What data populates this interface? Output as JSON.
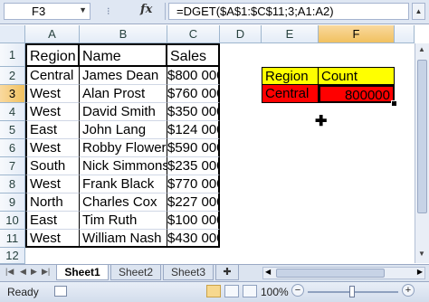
{
  "formula_bar": {
    "name_box": "F3",
    "fx": "fx",
    "formula": "=DGET($A$1:$C$11;3;A1:A2)"
  },
  "columns": [
    "A",
    "B",
    "C",
    "D",
    "E",
    "F"
  ],
  "rows": [
    "1",
    "2",
    "3",
    "4",
    "5",
    "6",
    "7",
    "8",
    "9",
    "10",
    "11",
    "12"
  ],
  "headers": {
    "region": "Region",
    "name": "Name",
    "sales": "Sales"
  },
  "data": [
    {
      "region": "Central",
      "name": "James Dean",
      "sales": "$800 000"
    },
    {
      "region": "West",
      "name": "Alan Prost",
      "sales": "$760 000"
    },
    {
      "region": "West",
      "name": "David Smith",
      "sales": "$350 000"
    },
    {
      "region": "East",
      "name": "John Lang",
      "sales": "$124 000"
    },
    {
      "region": "West",
      "name": "Robby Flowers",
      "sales": "$590 000"
    },
    {
      "region": "South",
      "name": "Nick Simmons",
      "sales": "$235 000"
    },
    {
      "region": "West",
      "name": "Frank Black",
      "sales": "$770 000"
    },
    {
      "region": "North",
      "name": "Charles Cox",
      "sales": "$227 000"
    },
    {
      "region": "East",
      "name": "Tim Ruth",
      "sales": "$100 000"
    },
    {
      "region": "West",
      "name": "William Nash",
      "sales": "$430 000"
    }
  ],
  "criteria": {
    "region_label": "Region",
    "count_label": "Count",
    "region_value": "Central",
    "count_value": "800000"
  },
  "colors": {
    "yellow": "#ffff00",
    "red": "#ff0000",
    "selected_header": "#f1c15f"
  },
  "tabs": [
    "Sheet1",
    "Sheet2",
    "Sheet3"
  ],
  "status": {
    "ready": "Ready",
    "zoom": "100%"
  }
}
